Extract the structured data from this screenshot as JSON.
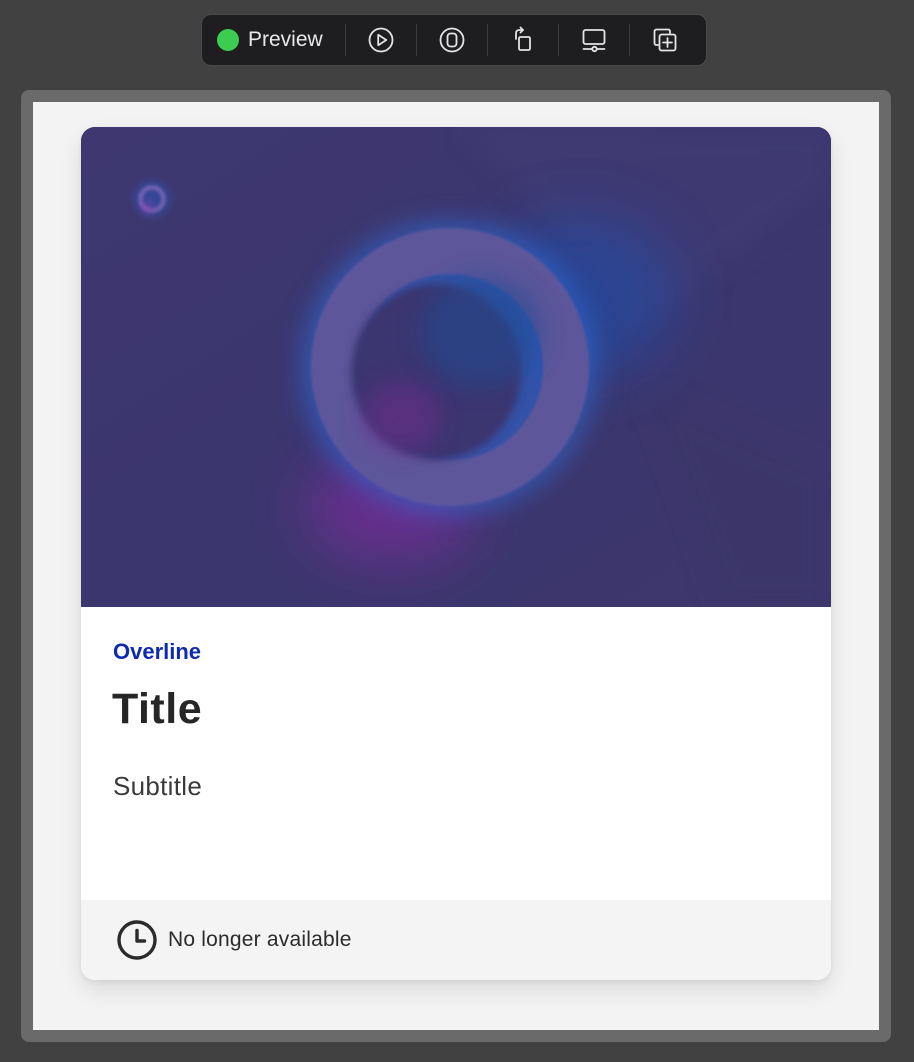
{
  "toolbar": {
    "preview_label": "Preview",
    "status_color": "#3ecb52",
    "icons": [
      "play-circle-icon",
      "device-icon",
      "rotate-icon",
      "display-settings-icon",
      "duplicate-icon"
    ]
  },
  "card": {
    "overline": "Overline",
    "title": "Title",
    "subtitle": "Subtitle",
    "footer_text": "No longer available",
    "footer_icon": "clock-icon",
    "colors": {
      "overline": "#0e2bb0",
      "hero_background": "#3e376f",
      "ring": "#5d579b"
    }
  }
}
